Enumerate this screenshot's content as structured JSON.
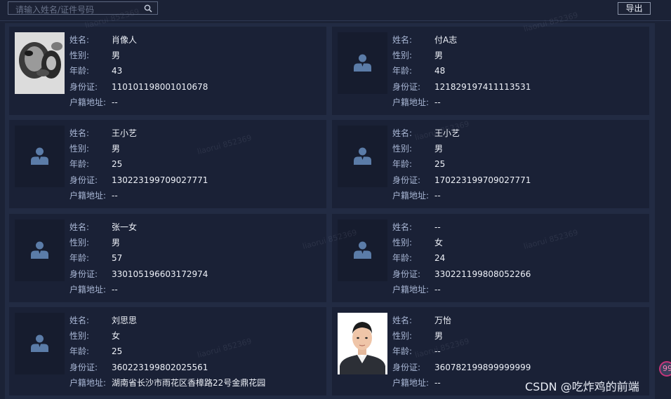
{
  "search": {
    "placeholder": "请输入姓名/证件号码",
    "value": ""
  },
  "toolbar": {
    "export_label": "导出"
  },
  "labels": {
    "name": "姓名:",
    "gender": "性别:",
    "age": "年龄:",
    "id": "身份证:",
    "address": "户籍地址:"
  },
  "cards": [
    {
      "photo": "blurred",
      "name": "肖像人",
      "gender": "男",
      "age": "43",
      "id": "110101198001010678",
      "address": "--"
    },
    {
      "photo": "placeholder",
      "name": "付A志",
      "gender": "男",
      "age": "48",
      "id": "121829197411113531",
      "address": "--"
    },
    {
      "photo": "placeholder",
      "name": "王小艺",
      "gender": "男",
      "age": "25",
      "id": "130223199709027771",
      "address": "--"
    },
    {
      "photo": "placeholder",
      "name": "王小艺",
      "gender": "男",
      "age": "25",
      "id": "170223199709027771",
      "address": "--"
    },
    {
      "photo": "placeholder",
      "name": "张一女",
      "gender": "男",
      "age": "57",
      "id": "330105196603172974",
      "address": "--"
    },
    {
      "photo": "placeholder",
      "name": "--",
      "gender": "女",
      "age": "24",
      "id": "330221199808052266",
      "address": "--"
    },
    {
      "photo": "placeholder",
      "name": "刘思思",
      "gender": "女",
      "age": "25",
      "id": "360223199802025561",
      "address": "湖南省长沙市雨花区香樟路22号金鼎花园"
    },
    {
      "photo": "portrait",
      "name": "万怡",
      "gender": "男",
      "age": "--",
      "id": "360782199899999999",
      "address": "--"
    }
  ],
  "watermark_text": "liaorui 852369",
  "footer": {
    "credit": "CSDN @吃炸鸡的前端",
    "badge": "99"
  },
  "colors": {
    "background": "#1b2236",
    "card": "#1a2136",
    "label": "#a8b6d4",
    "value": "#eef1f8"
  }
}
